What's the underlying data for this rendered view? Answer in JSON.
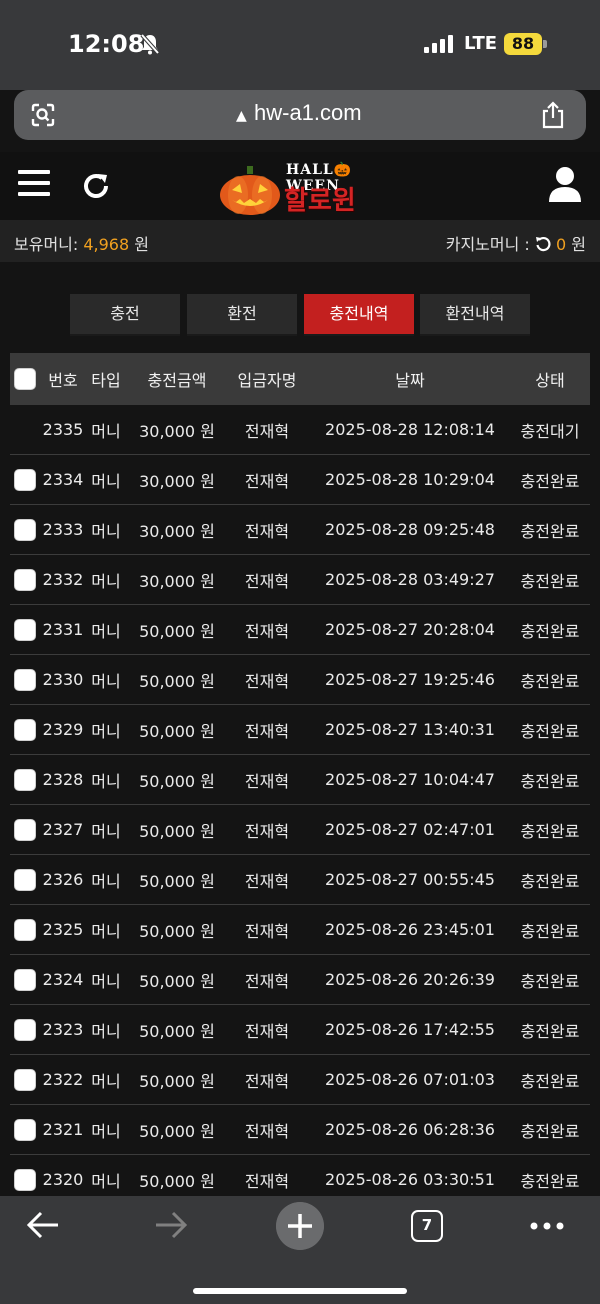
{
  "status_bar": {
    "time": "12:08",
    "network": "LTE",
    "battery": "88"
  },
  "browser": {
    "url": "hw-a1.com",
    "tab_count": "7"
  },
  "header": {
    "logo_top": "HALL🎃WEEN",
    "logo_brand": "할로윈"
  },
  "wallet": {
    "label_left": "보유머니: ",
    "money": "4,968",
    "unit_left": " 원",
    "label_right": "카지노머니 : ",
    "casino": "0",
    "unit_right": " 원"
  },
  "tabs": [
    {
      "label": "충전",
      "active": false
    },
    {
      "label": "환전",
      "active": false
    },
    {
      "label": "충전내역",
      "active": true
    },
    {
      "label": "환전내역",
      "active": false
    }
  ],
  "table": {
    "headers": {
      "no": "번호",
      "type": "타입",
      "amount": "충전금액",
      "name": "입금자명",
      "date": "날짜",
      "status": "상태"
    },
    "rows": [
      {
        "no": "2335",
        "type": "머니",
        "amount": "30,000 원",
        "name": "전재혁",
        "date": "2025-08-28 12:08:14",
        "status": "충전대기",
        "checkbox": false
      },
      {
        "no": "2334",
        "type": "머니",
        "amount": "30,000 원",
        "name": "전재혁",
        "date": "2025-08-28 10:29:04",
        "status": "충전완료",
        "checkbox": true
      },
      {
        "no": "2333",
        "type": "머니",
        "amount": "30,000 원",
        "name": "전재혁",
        "date": "2025-08-28 09:25:48",
        "status": "충전완료",
        "checkbox": true
      },
      {
        "no": "2332",
        "type": "머니",
        "amount": "30,000 원",
        "name": "전재혁",
        "date": "2025-08-28 03:49:27",
        "status": "충전완료",
        "checkbox": true
      },
      {
        "no": "2331",
        "type": "머니",
        "amount": "50,000 원",
        "name": "전재혁",
        "date": "2025-08-27 20:28:04",
        "status": "충전완료",
        "checkbox": true
      },
      {
        "no": "2330",
        "type": "머니",
        "amount": "50,000 원",
        "name": "전재혁",
        "date": "2025-08-27 19:25:46",
        "status": "충전완료",
        "checkbox": true
      },
      {
        "no": "2329",
        "type": "머니",
        "amount": "50,000 원",
        "name": "전재혁",
        "date": "2025-08-27 13:40:31",
        "status": "충전완료",
        "checkbox": true
      },
      {
        "no": "2328",
        "type": "머니",
        "amount": "50,000 원",
        "name": "전재혁",
        "date": "2025-08-27 10:04:47",
        "status": "충전완료",
        "checkbox": true
      },
      {
        "no": "2327",
        "type": "머니",
        "amount": "50,000 원",
        "name": "전재혁",
        "date": "2025-08-27 02:47:01",
        "status": "충전완료",
        "checkbox": true
      },
      {
        "no": "2326",
        "type": "머니",
        "amount": "50,000 원",
        "name": "전재혁",
        "date": "2025-08-27 00:55:45",
        "status": "충전완료",
        "checkbox": true
      },
      {
        "no": "2325",
        "type": "머니",
        "amount": "50,000 원",
        "name": "전재혁",
        "date": "2025-08-26 23:45:01",
        "status": "충전완료",
        "checkbox": true
      },
      {
        "no": "2324",
        "type": "머니",
        "amount": "50,000 원",
        "name": "전재혁",
        "date": "2025-08-26 20:26:39",
        "status": "충전완료",
        "checkbox": true
      },
      {
        "no": "2323",
        "type": "머니",
        "amount": "50,000 원",
        "name": "전재혁",
        "date": "2025-08-26 17:42:55",
        "status": "충전완료",
        "checkbox": true
      },
      {
        "no": "2322",
        "type": "머니",
        "amount": "50,000 원",
        "name": "전재혁",
        "date": "2025-08-26 07:01:03",
        "status": "충전완료",
        "checkbox": true
      },
      {
        "no": "2321",
        "type": "머니",
        "amount": "50,000 원",
        "name": "전재혁",
        "date": "2025-08-26 06:28:36",
        "status": "충전완료",
        "checkbox": true
      },
      {
        "no": "2320",
        "type": "머니",
        "amount": "50,000 원",
        "name": "전재혁",
        "date": "2025-08-26 03:30:51",
        "status": "충전완료",
        "checkbox": true
      }
    ]
  },
  "colors": {
    "accent": "#c3201f",
    "money": "#f0a020"
  }
}
